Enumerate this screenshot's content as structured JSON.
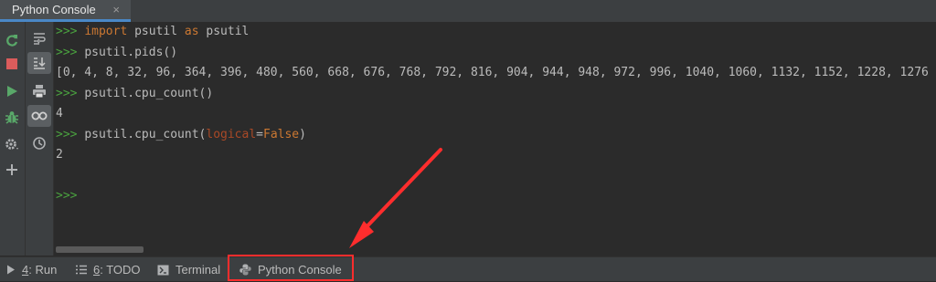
{
  "top_tab": {
    "label": "Python Console",
    "close": "×"
  },
  "left_toolbar": {
    "icons": [
      "rerun-icon",
      "stop-icon",
      "run-icon",
      "debug-icon",
      "settings-icon",
      "add-icon"
    ]
  },
  "console_toolbar": {
    "icons": [
      "soft-wrap-icon",
      "scroll-to-end-icon",
      "print-icon",
      "show-variables-icon",
      "history-icon"
    ]
  },
  "console": {
    "prompt": ">>>",
    "lines": [
      {
        "kind": "input",
        "parts": [
          {
            "t": "import",
            "c": "kw"
          },
          {
            "t": " psutil ",
            "c": "plain"
          },
          {
            "t": "as",
            "c": "kw"
          },
          {
            "t": " psutil",
            "c": "plain"
          }
        ]
      },
      {
        "kind": "input",
        "parts": [
          {
            "t": "psutil.pids()",
            "c": "plain"
          }
        ]
      },
      {
        "kind": "output",
        "text": "[0, 4, 8, 32, 96, 364, 396, 480, 560, 668, 676, 768, 792, 816, 904, 944, 948, 972, 996, 1040, 1060, 1132, 1152, 1228, 1276"
      },
      {
        "kind": "input",
        "parts": [
          {
            "t": "psutil.cpu_count()",
            "c": "plain"
          }
        ]
      },
      {
        "kind": "output",
        "text": "4"
      },
      {
        "kind": "input",
        "parts": [
          {
            "t": "psutil.cpu_count(",
            "c": "plain"
          },
          {
            "t": "logical",
            "c": "param"
          },
          {
            "t": "=",
            "c": "plain"
          },
          {
            "t": "False",
            "c": "kw"
          },
          {
            "t": ")",
            "c": "plain"
          }
        ]
      },
      {
        "kind": "output",
        "text": "2"
      },
      {
        "kind": "blank"
      },
      {
        "kind": "prompt-only"
      }
    ]
  },
  "bottom_tabs": [
    {
      "num": "4",
      "label": ": Run",
      "icon": "run-triangle-icon"
    },
    {
      "num": "6",
      "label": ": TODO",
      "icon": "todo-list-icon"
    },
    {
      "num": "",
      "label": "Terminal",
      "icon": "terminal-icon"
    },
    {
      "num": "",
      "label": "Python Console",
      "icon": "python-icon"
    }
  ],
  "colors": {
    "background": "#2b2b2b",
    "panel": "#3c3f41",
    "prompt": "#4aa33f",
    "keyword": "#cc7832",
    "annotation_red": "#ff2d2d"
  }
}
